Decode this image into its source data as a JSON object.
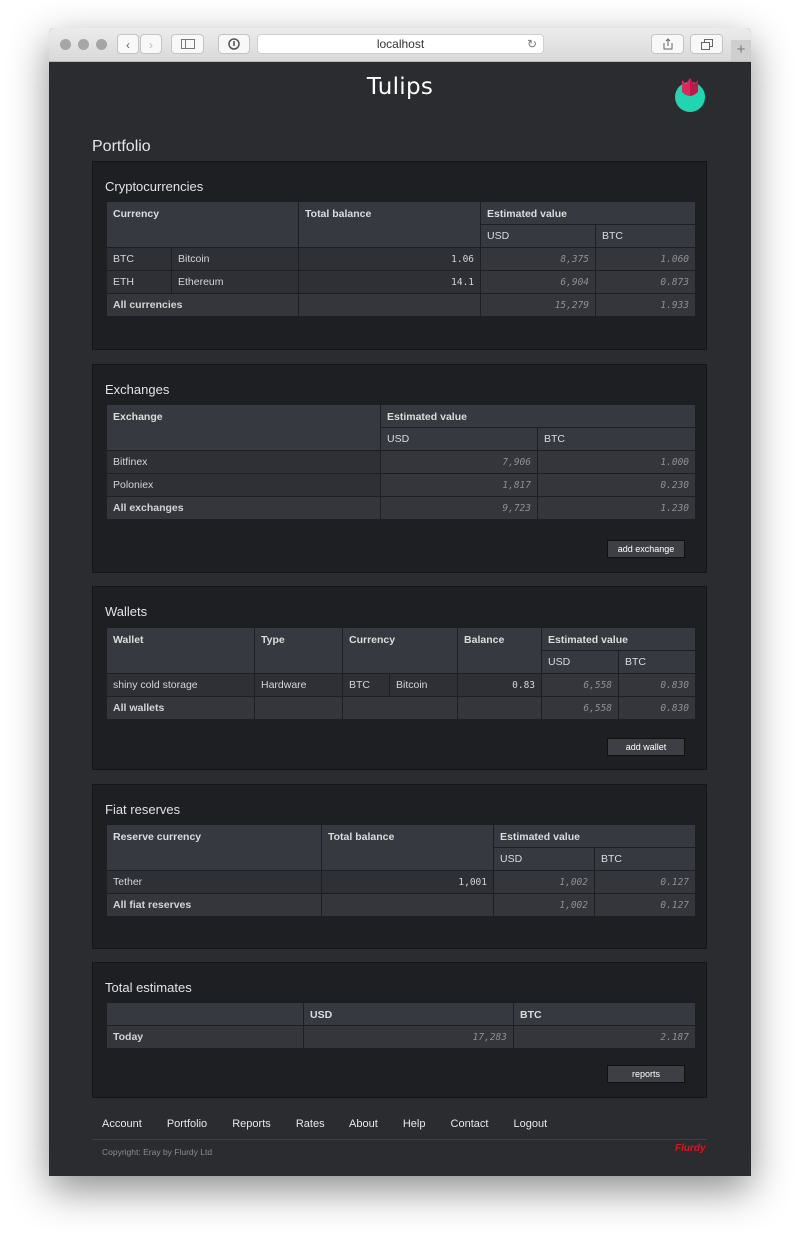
{
  "browser": {
    "url": "localhost"
  },
  "app": {
    "title": "Tulips",
    "page_title": "Portfolio"
  },
  "crypto": {
    "title": "Cryptocurrencies",
    "headers": {
      "currency": "Currency",
      "total": "Total balance",
      "estimated": "Estimated value",
      "usd": "USD",
      "btc": "BTC"
    },
    "rows": [
      {
        "code": "BTC",
        "name": "Bitcoin",
        "balance": "1.06",
        "usd": "8,375",
        "btc": "1.060"
      },
      {
        "code": "ETH",
        "name": "Ethereum",
        "balance": "14.1",
        "usd": "6,904",
        "btc": "0.873"
      }
    ],
    "total": {
      "label": "All currencies",
      "usd": "15,279",
      "btc": "1.933"
    }
  },
  "exchanges": {
    "title": "Exchanges",
    "headers": {
      "exchange": "Exchange",
      "estimated": "Estimated value",
      "usd": "USD",
      "btc": "BTC"
    },
    "rows": [
      {
        "name": "Bitfinex",
        "usd": "7,906",
        "btc": "1.000"
      },
      {
        "name": "Poloniex",
        "usd": "1,817",
        "btc": "0.230"
      }
    ],
    "total": {
      "label": "All exchanges",
      "usd": "9,723",
      "btc": "1.230"
    },
    "button": "add exchange"
  },
  "wallets": {
    "title": "Wallets",
    "headers": {
      "wallet": "Wallet",
      "type": "Type",
      "currency": "Currency",
      "balance": "Balance",
      "estimated": "Estimated value",
      "usd": "USD",
      "btc": "BTC"
    },
    "rows": [
      {
        "name": "shiny cold storage",
        "type": "Hardware",
        "code": "BTC",
        "currency": "Bitcoin",
        "balance": "0.83",
        "usd": "6,558",
        "btc": "0.830"
      }
    ],
    "total": {
      "label": "All wallets",
      "usd": "6,558",
      "btc": "0.830"
    },
    "button": "add wallet"
  },
  "fiat": {
    "title": "Fiat reserves",
    "headers": {
      "reserve": "Reserve currency",
      "total": "Total balance",
      "estimated": "Estimated value",
      "usd": "USD",
      "btc": "BTC"
    },
    "rows": [
      {
        "name": "Tether",
        "balance": "1,001",
        "usd": "1,002",
        "btc": "0.127"
      }
    ],
    "total": {
      "label": "All fiat reserves",
      "usd": "1,002",
      "btc": "0.127"
    }
  },
  "totals": {
    "title": "Total estimates",
    "headers": {
      "usd": "USD",
      "btc": "BTC"
    },
    "today": {
      "label": "Today",
      "usd": "17,283",
      "btc": "2.187"
    },
    "button": "reports"
  },
  "footer": {
    "links": [
      "Account",
      "Portfolio",
      "Reports",
      "Rates",
      "About",
      "Help",
      "Contact",
      "Logout"
    ],
    "copyright": "Copyright: Eray by Flurdy Ltd",
    "brand": "Flurdy"
  },
  "colors": {
    "background": "#2a2c30",
    "panel": "#1e1f22",
    "header_cell": "#363940",
    "logo_teal": "#1fd6b0",
    "logo_pink": "#e3245f",
    "flurdy_red": "#e0131a"
  }
}
